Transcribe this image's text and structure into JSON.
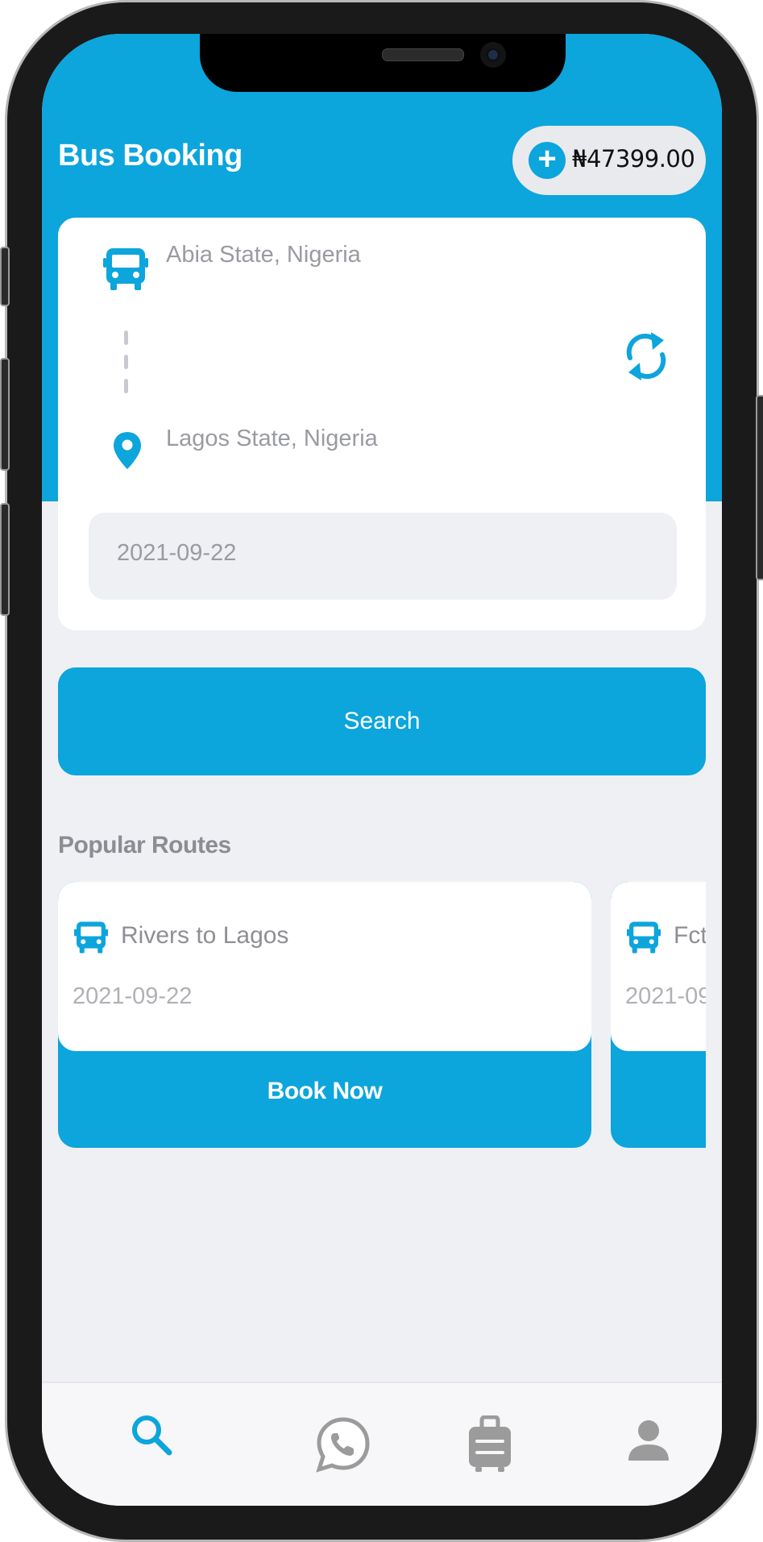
{
  "header": {
    "title": "Bus Booking",
    "wallet_balance": "₦47399.00"
  },
  "search_form": {
    "from_location": "Abia State, Nigeria",
    "to_location": "Lagos State, Nigeria",
    "date": "2021-09-22",
    "search_label": "Search"
  },
  "popular_routes": {
    "title": "Popular Routes",
    "items": [
      {
        "name": "Rivers to Lagos",
        "date": "2021-09-22",
        "book_label": "Book Now"
      },
      {
        "name": "Fct",
        "date": "2021-09",
        "book_label": ""
      }
    ]
  },
  "bottom_nav": {
    "items": [
      {
        "icon": "search-icon",
        "active": true
      },
      {
        "icon": "whatsapp-icon",
        "active": false
      },
      {
        "icon": "luggage-icon",
        "active": false
      },
      {
        "icon": "user-icon",
        "active": false
      }
    ]
  },
  "colors": {
    "accent": "#0ca5dc",
    "background": "#eff0f4",
    "muted_text": "#9a9ba2",
    "inactive_icon": "#9b9b9b"
  }
}
